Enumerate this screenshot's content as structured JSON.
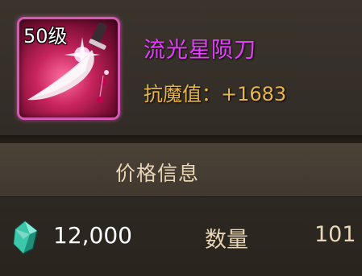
{
  "item": {
    "level_badge": "50级",
    "name": "流光星陨刀",
    "stat_label": "抗魔值：",
    "stat_value": "+1683",
    "icon": "curved-blade-icon",
    "rarity_color": "#e83cff"
  },
  "price_info": {
    "header": "价格信息",
    "currency_icon": "green-gem-icon",
    "price": "12,000",
    "quantity_label": "数量",
    "quantity": "101"
  }
}
